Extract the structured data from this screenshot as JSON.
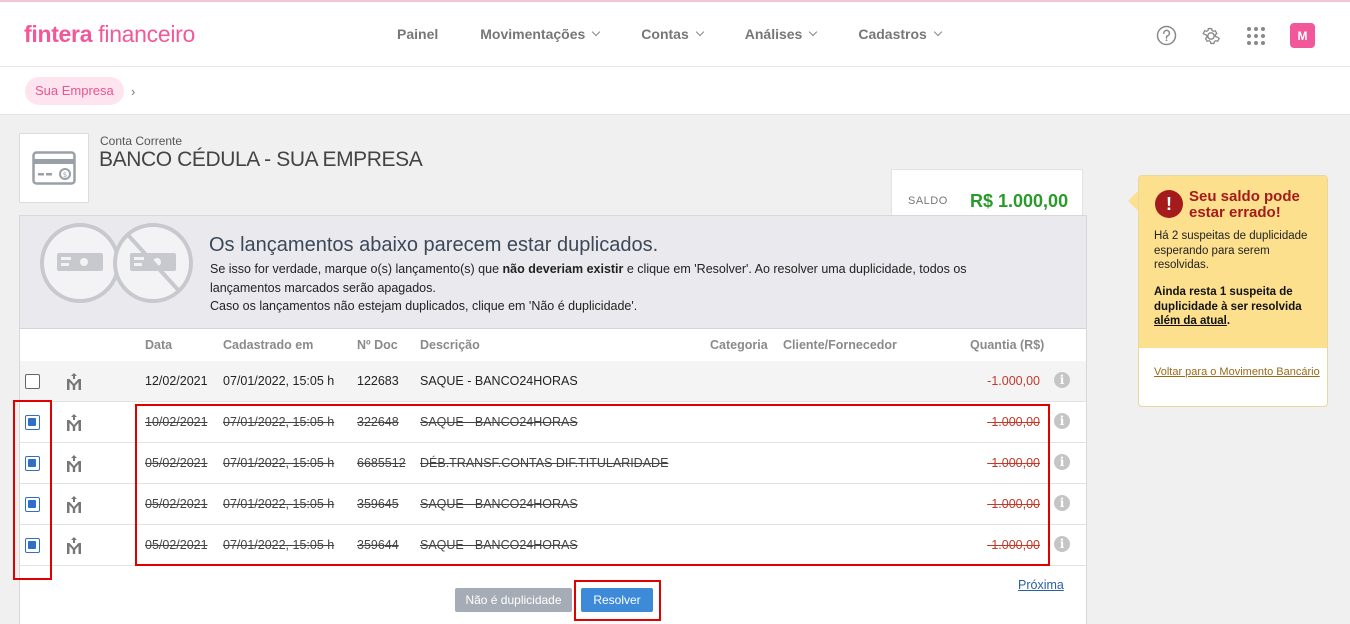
{
  "brand": {
    "part1": "fintera",
    "part2": " financeiro",
    "accent": "#f2579a"
  },
  "nav": {
    "items": [
      {
        "label": "Painel",
        "dropdown": false
      },
      {
        "label": "Movimentações",
        "dropdown": true
      },
      {
        "label": "Contas",
        "dropdown": true
      },
      {
        "label": "Análises",
        "dropdown": true
      },
      {
        "label": "Cadastros",
        "dropdown": true
      }
    ],
    "icons": [
      "help-icon",
      "gear-icon",
      "apps-grid-icon"
    ],
    "avatar_letter": "M"
  },
  "breadcrumb": {
    "company": "Sua Empresa",
    "separator": "›"
  },
  "account": {
    "type": "Conta Corrente",
    "name": "BANCO CÉDULA - SUA EMPRESA",
    "saldo_label": "SALDO",
    "saldo_value": "R$ 1.000,00"
  },
  "banner": {
    "title": "Os lançamentos abaixo parecem estar duplicados.",
    "line1_a": "Se isso for verdade, marque o(s) lançamento(s) que ",
    "line1_bold": "não deveriam existir",
    "line1_b": " e clique em 'Resolver'. Ao resolver uma duplicidade, todos os lançamentos marcados serão apagados.",
    "line2": "Caso os lançamentos não estejam duplicados, clique em 'Não é duplicidade'."
  },
  "table": {
    "headers": {
      "data": "Data",
      "cadastrado": "Cadastrado em",
      "doc": "Nº Doc",
      "descricao": "Descrição",
      "categoria": "Categoria",
      "cliente": "Cliente/Fornecedor",
      "quantia": "Quantia (R$)"
    },
    "rows": [
      {
        "checked": false,
        "struck": false,
        "data": "12/02/2021",
        "cadastrado": "07/01/2022, 15:05 h",
        "doc": "122683",
        "descricao": "SAQUE - BANCO24HORAS",
        "quantia": "-1.000,00"
      },
      {
        "checked": true,
        "struck": true,
        "data": "10/02/2021",
        "cadastrado": "07/01/2022, 15:05 h",
        "doc": "322648",
        "descricao": "SAQUE - BANCO24HORAS",
        "quantia": "-1.000,00"
      },
      {
        "checked": true,
        "struck": true,
        "data": "05/02/2021",
        "cadastrado": "07/01/2022, 15:05 h",
        "doc": "6685512",
        "descricao": "DÉB.TRANSF.CONTAS DIF.TITULARIDADE",
        "quantia": "-1.000,00"
      },
      {
        "checked": true,
        "struck": true,
        "data": "05/02/2021",
        "cadastrado": "07/01/2022, 15:05 h",
        "doc": "359645",
        "descricao": "SAQUE - BANCO24HORAS",
        "quantia": "-1.000,00"
      },
      {
        "checked": true,
        "struck": true,
        "data": "05/02/2021",
        "cadastrado": "07/01/2022, 15:05 h",
        "doc": "359644",
        "descricao": "SAQUE - BANCO24HORAS",
        "quantia": "-1.000,00"
      }
    ]
  },
  "actions": {
    "proxima": "Próxima",
    "nao_duplicidade": "Não é duplicidade",
    "resolver": "Resolver"
  },
  "alert": {
    "title": "Seu saldo pode estar errado!",
    "p1": "Há 2 suspeitas de duplicidade esperando para serem resolvidas.",
    "p2_a": "Ainda resta 1 suspeita de duplicidade à ser resolvida ",
    "p2_u": "além da atual",
    "p2_b": ".",
    "link": "Voltar para o Movimento Bancário"
  }
}
